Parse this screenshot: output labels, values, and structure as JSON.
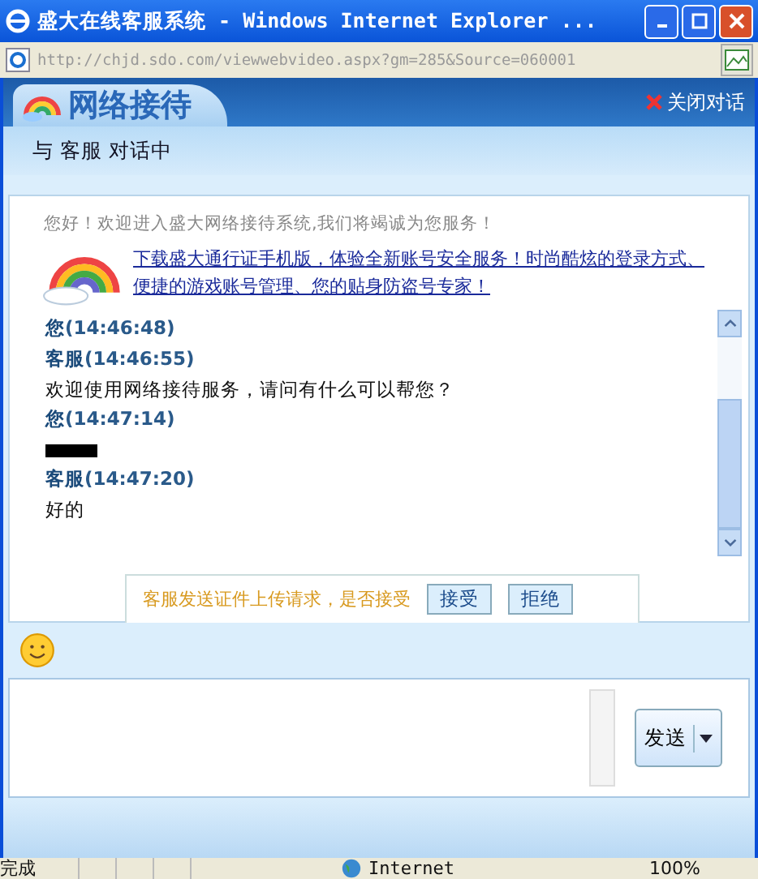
{
  "window": {
    "title": "盛大在线客服系统 - Windows Internet Explorer ..."
  },
  "address_bar": {
    "url": "http://chjd.sdo.com/viewwebvideo.aspx?gm=285&Source=060001"
  },
  "header": {
    "logo_text": "网络接待",
    "close_link": "关闭对话"
  },
  "status_line": "与 客服 对话中",
  "welcome": "您好！欢迎进入盛大网络接待系统,我们将竭诚为您服务！",
  "promo_link": "下载盛大通行证手机版，体验全新账号安全服务！时尚酷炫的登录方式、便捷的游戏账号管理、您的贴身防盗号专家！",
  "messages": [
    {
      "sender": "您",
      "time": "(14:46:48)"
    },
    {
      "sender": "客服",
      "time": "(14:46:55)",
      "text": "欢迎使用网络接待服务，请问有什么可以帮您？"
    },
    {
      "sender": "您",
      "time": "(14:47:14)",
      "redacted": true
    },
    {
      "sender": "客服",
      "time": "(14:47:20)",
      "text": "好的"
    }
  ],
  "notice": {
    "text": "客服发送证件上传请求，是否接受",
    "buttons": [
      "接受",
      "拒绝"
    ]
  },
  "send_button": "发送",
  "status_bar": {
    "status": "完成",
    "zone": "Internet",
    "zoom": "100%"
  }
}
